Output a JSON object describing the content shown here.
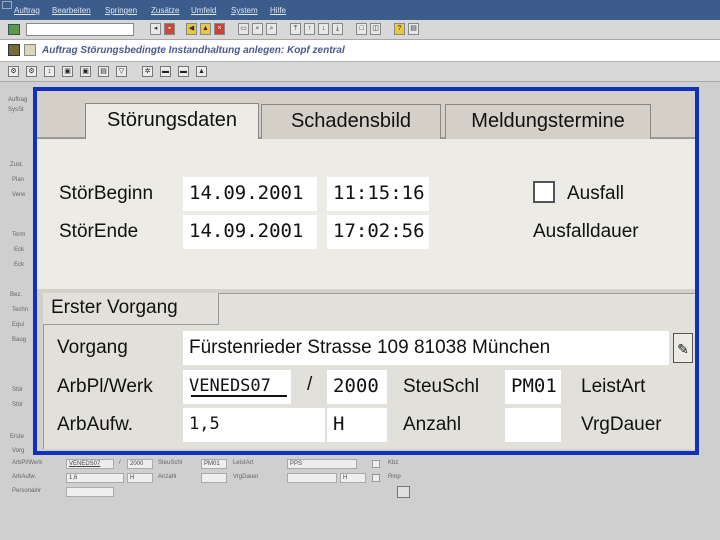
{
  "menu": [
    "Auftrag",
    "Bearbeiten",
    "Springen",
    "Zusätze",
    "Umfeld",
    "System",
    "Hilfe"
  ],
  "window": {
    "title": "Auftrag Störungsbedingte Instandhaltung anlegen: Kopf zentral"
  },
  "tabs": [
    "Störungsdaten",
    "Schadensbild",
    "Meldungstermine"
  ],
  "stoer": {
    "begin_label": "StörBeginn",
    "begin_date": "14.09.2001",
    "begin_time": "11:15:16",
    "ende_label": "StörEnde",
    "ende_date": "14.09.2001",
    "ende_time": "17:02:56",
    "ausfall_label": "Ausfall",
    "ausfalldauer_label": "Ausfalldauer"
  },
  "vorgang": {
    "section_title": "Erster Vorgang",
    "vorgang_label": "Vorgang",
    "vorgang_value": "Fürstenrieder Strasse 109 81038 München",
    "arbplwerk_label": "ArbPl/Werk",
    "arbpl_value": "VENEDS07",
    "slash": "/",
    "werk_value": "2000",
    "steuschl_label": "SteuSchl",
    "steuschl_value": "PM01",
    "leistart_label": "LeistArt",
    "arbaufw_label": "ArbAufw.",
    "arbaufw_value": "1,5",
    "arbaufw_unit": "H",
    "anzahl_label": "Anzahl",
    "vrgdauer_label": "VrgDauer"
  },
  "background": {
    "arbpl_label": "ArbPl/Werk",
    "arbpl_value": "VENEDS07",
    "werk": "2000",
    "steu_label": "SteuSchl",
    "steu": "PM01",
    "leist_label": "LeistArt",
    "leist": "PPS",
    "aufw_label": "ArbAufw.",
    "aufw": "1,6",
    "unit": "H",
    "anz_label": "Anzahl",
    "vrg_label": "VrgDauer",
    "vrg_unit": "H",
    "kbz_label": "Kbz",
    "rmp_label": "Rmp",
    "pers_label": "Personalnr"
  },
  "colors": {
    "frame": "#1030c0",
    "menubar": "#3c5c8c",
    "title_text": "#4a5a8a"
  }
}
